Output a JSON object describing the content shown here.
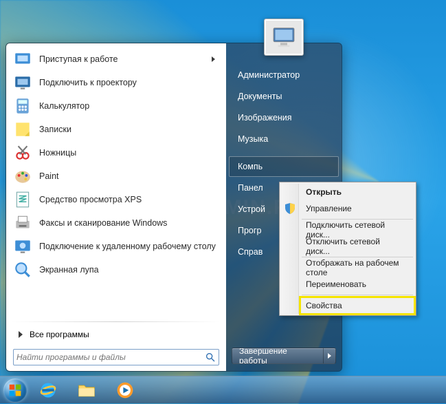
{
  "left_programs": [
    {
      "label": "Приступая к работе",
      "has_submenu": true,
      "icon": "getting-started"
    },
    {
      "label": "Подключить к проектору",
      "icon": "projector"
    },
    {
      "label": "Калькулятор",
      "icon": "calculator"
    },
    {
      "label": "Записки",
      "icon": "sticky-notes"
    },
    {
      "label": "Ножницы",
      "icon": "snipping"
    },
    {
      "label": "Paint",
      "icon": "paint"
    },
    {
      "label": "Средство просмотра XPS",
      "icon": "xps"
    },
    {
      "label": "Факсы и сканирование Windows",
      "icon": "fax"
    },
    {
      "label": "Подключение к удаленному рабочему столу",
      "icon": "rdp"
    },
    {
      "label": "Экранная лупа",
      "icon": "magnifier"
    }
  ],
  "all_programs_label": "Все программы",
  "search": {
    "placeholder": "Найти программы и файлы"
  },
  "right_items": [
    {
      "label": "Администратор"
    },
    {
      "label": "Документы"
    },
    {
      "label": "Изображения"
    },
    {
      "label": "Музыка"
    },
    {
      "label": "Компьютер",
      "selected": true,
      "truncated": "Компь"
    },
    {
      "label": "Панель управления",
      "truncated": "Панел"
    },
    {
      "label": "Устройства и принтеры",
      "truncated": "Устрой"
    },
    {
      "label": "Программы по умолчанию",
      "truncated": "Прогр"
    },
    {
      "label": "Справка и поддержка",
      "truncated": "Справ"
    }
  ],
  "shutdown_label": "Завершение работы",
  "context_menu": [
    {
      "label": "Открыть",
      "bold": true
    },
    {
      "label": "Управление",
      "icon": "shield"
    },
    {
      "sep": true
    },
    {
      "label": "Подключить сетевой диск..."
    },
    {
      "label": "Отключить сетевой диск..."
    },
    {
      "sep": true
    },
    {
      "label": "Отображать на рабочем столе"
    },
    {
      "label": "Переименовать"
    },
    {
      "sep": true
    },
    {
      "label": "Свойства",
      "highlight": true
    }
  ],
  "watermark": "CRAZYSYSADMIN.RU"
}
